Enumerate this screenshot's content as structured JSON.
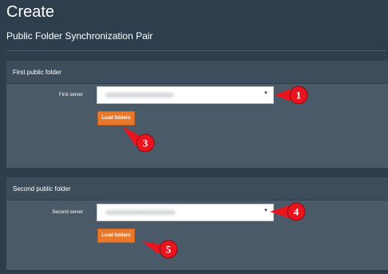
{
  "page": {
    "title": "Create",
    "subtitle": "Public Folder Synchronization Pair"
  },
  "first_folder": {
    "header": "First public folder",
    "server_label": "First server",
    "server_value": "",
    "load_button": "Load folders"
  },
  "second_folder": {
    "header": "Second public folder",
    "server_label": "Second server",
    "server_value": "",
    "load_button": "Load folders"
  },
  "callouts": [
    "1",
    "3",
    "4",
    "5"
  ],
  "colors": {
    "background": "#2f3e4c",
    "panel": "#4b5a68",
    "button": "#e8782b",
    "callout": "#e8141e"
  }
}
